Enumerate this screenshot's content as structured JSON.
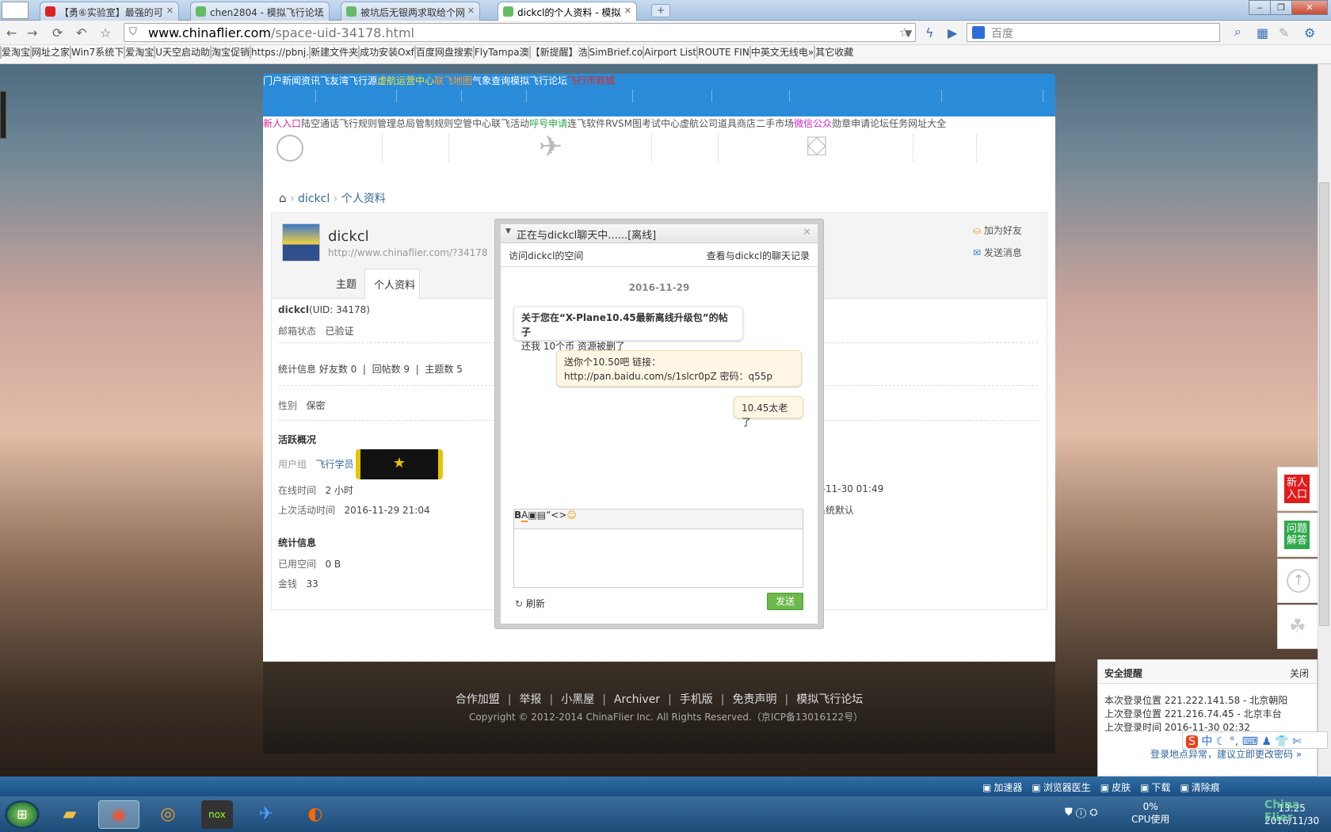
{
  "browser": {
    "tabs": [
      {
        "title": "【勇⑥实验室】最强的可",
        "active": false
      },
      {
        "title": "chen2804 - 模拟飞行论坛",
        "active": false
      },
      {
        "title": "被坑后无银两求取给个网",
        "active": false
      },
      {
        "title": "dickcl的个人资料 - 模拟",
        "active": true
      }
    ],
    "url_host": "www.chinaflier.com",
    "url_path": "/space-uid-34178.html",
    "search_placeholder": "百度",
    "bookmarks": [
      "爱淘宝",
      "网址之家",
      "Win7系统下",
      "爱淘宝",
      "U天空启动助",
      "淘宝促销",
      "https://pbnj.",
      "新建文件夹",
      "成功安装Oxf",
      "百度网盘搜索",
      "FlyTampa澳",
      "【新提醒】浩",
      "SimBrief.co",
      "Airport List",
      "ROUTE FIN",
      "中英文无线电",
      "其它收藏"
    ],
    "bookmark_more": "»"
  },
  "site": {
    "nav": [
      {
        "label": "门户",
        "color": "#ffffff"
      },
      {
        "label": "新闻资讯",
        "color": "#ffffff"
      },
      {
        "label": "飞友湾",
        "color": "#ffffff"
      },
      {
        "label": "飞行源",
        "color": "#ffffff"
      },
      {
        "label": "虚航运营中心",
        "color": "#f5e23b"
      },
      {
        "label": "联飞地图",
        "color": "#ff9a2e"
      },
      {
        "label": "气象查询",
        "color": "#ffffff"
      },
      {
        "label": "模拟飞行论坛",
        "color": "#ffffff"
      },
      {
        "label": "飞行币商城",
        "color": "#e8231a"
      }
    ],
    "subnav": {
      "group1": [
        [
          "新人入口",
          "陆空通话",
          "飞行规则"
        ],
        [
          "管理总局",
          "管制规则",
          "空管中心"
        ]
      ],
      "group2": [
        [
          "联飞活动",
          "呼号申请",
          "连飞软件"
        ],
        [
          "RVSM图",
          "考试中心",
          "虚航公司"
        ]
      ],
      "group3": [
        [
          "道具商店",
          "二手市场",
          "微信公众"
        ],
        [
          "勋章申请",
          "论坛任务",
          "网址大全"
        ]
      ]
    },
    "breadcrumb": [
      "dickcl",
      "个人资料"
    ]
  },
  "profile": {
    "username": "dickcl",
    "space_url": "http://www.chinaflier.com/?34178",
    "add_friend": "加为好友",
    "send_message": "发送消息",
    "tabs": [
      "主题",
      "个人资料"
    ],
    "uid_line": "(UID: 34178)",
    "email_label": "邮箱状态",
    "email_value": "已验证",
    "stats_label": "统计信息",
    "friends": "好友数 0",
    "replies": "回帖数 9",
    "threads": "主题数 5",
    "gender_label": "性别",
    "gender_value": "保密",
    "activity_title": "活跃概况",
    "group_label": "用户组",
    "group_value": "飞行学员",
    "online_label": "在线时间",
    "online_value": "2 小时",
    "last_active_label": "上次活动时间",
    "last_active_value": "2016-11-29 21:04",
    "right_time_fragment": "6-11-30 01:49",
    "right_tz_fragment": "系统默认",
    "stat_title": "统计信息",
    "space_label": "已用空间",
    "space_value": "0 B",
    "money_label": "金钱",
    "money_value": "33"
  },
  "chat": {
    "title": "正在与dickcl聊天中......[离线]",
    "visit": "访问dickcl的空间",
    "history": "查看与dickcl的聊天记录",
    "date": "2016-11-29",
    "msg1_bold": "关于您在“X-Plane10.45最新离线升级包”的帖子",
    "msg1_text": "还我 10个币 资源被删了",
    "msg2_line1": "送你个10.50吧 链接：",
    "msg2_line2": "http://pan.baidu.com/s/1slcr0pZ 密码：q55p",
    "msg3": "10.45太老了",
    "toolbar": [
      "B",
      "A",
      "▣",
      "▤",
      "“",
      "<>",
      "☺"
    ],
    "refresh": "刷新",
    "send": "发送"
  },
  "side": {
    "new_user": "新人入口",
    "qa": "问题解答"
  },
  "footer": {
    "links": [
      "合作加盟",
      "举报",
      "小黑屋",
      "Archiver",
      "手机版",
      "免责声明",
      "模拟飞行论坛"
    ],
    "copyright": "Copyright © 2012-2014 ChinaFlier Inc.  All Rights Reserved.（京ICP备13016122号）"
  },
  "notice": {
    "title": "安全提醒",
    "close": "关闭",
    "line1": "本次登录位置 221.222.141.58 - 北京朝阳",
    "line2": "上次登录位置 221.216.74.45 - 北京丰台",
    "line3": "上次登录时间 2016-11-30 02:32",
    "link": "登录地点异常，建议立即更改密码 »"
  },
  "taskbar": {
    "tray_items": [
      "加速器",
      "浏览器医生",
      "皮肤",
      "下载",
      "清除痕"
    ],
    "cpu": "0%",
    "cpu_label": "CPU使用",
    "time": "13:25",
    "date": "2016/11/30",
    "watermark": "China Flier"
  }
}
